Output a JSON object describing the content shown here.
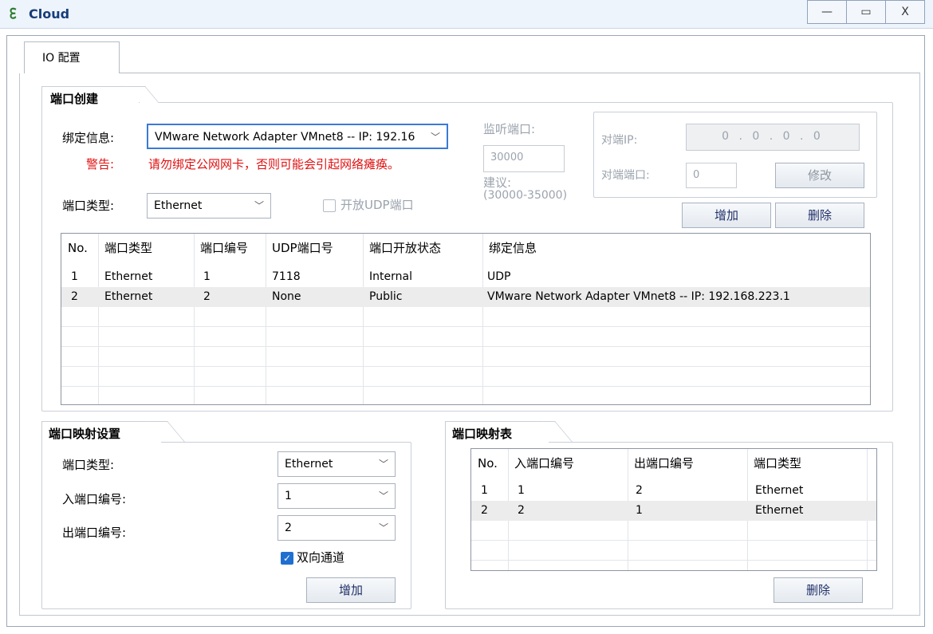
{
  "window": {
    "title": "Cloud",
    "icon": "cloud-app-icon",
    "minimize": "—",
    "maximize": "▭",
    "close": "X"
  },
  "tabs": [
    {
      "label": "IO 配置"
    }
  ],
  "port_create": {
    "section": "端口创建",
    "bind_label": "绑定信息:",
    "bind_value": "VMware Network Adapter VMnet8 -- IP: 192.16",
    "warn_label": "警告:",
    "warn_text": "请勿绑定公网网卡，否则可能会引起网络瘫痪。",
    "listen_label": "监听端口:",
    "listen_value": "30000",
    "suggest_label": "建议:",
    "suggest_value": "(30000-35000)",
    "peer_ip_label": "对端IP:",
    "peer_ip_value": "0 . 0 . 0 . 0",
    "peer_port_label": "对端端口:",
    "peer_port_value": "0",
    "modify_button": "修改",
    "type_label": "端口类型:",
    "type_value": "Ethernet",
    "open_udp_label": "开放UDP端口",
    "add_button": "增加",
    "delete_button": "删除"
  },
  "ports_table": {
    "headers": [
      "No.",
      "端口类型",
      "端口编号",
      "UDP端口号",
      "端口开放状态",
      "绑定信息"
    ],
    "rows": [
      [
        "1",
        "Ethernet",
        "1",
        "7118",
        "Internal",
        "UDP"
      ],
      [
        "2",
        "Ethernet",
        "2",
        "None",
        "Public",
        "VMware Network Adapter VMnet8 -- IP: 192.168.223.1"
      ]
    ]
  },
  "mapping_settings": {
    "section": "端口映射设置",
    "type_label": "端口类型:",
    "type_value": "Ethernet",
    "in_label": "入端口编号:",
    "in_value": "1",
    "out_label": "出端口编号:",
    "out_value": "2",
    "bidirectional_label": "双向通道",
    "add_button": "增加"
  },
  "mapping_table": {
    "section": "端口映射表",
    "headers": [
      "No.",
      "入端口编号",
      "出端口编号",
      "端口类型"
    ],
    "rows": [
      [
        "1",
        "1",
        "2",
        "Ethernet"
      ],
      [
        "2",
        "2",
        "1",
        "Ethernet"
      ]
    ],
    "delete_button": "删除"
  }
}
